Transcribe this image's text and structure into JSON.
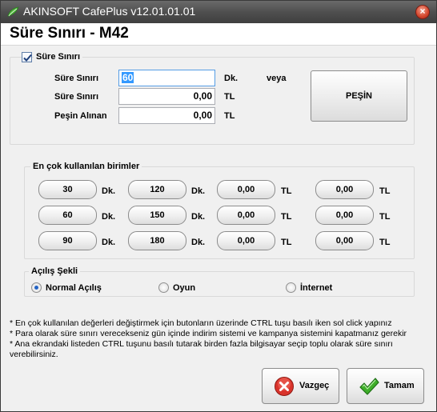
{
  "window": {
    "title": "AKINSOFT CafePlus v12.01.01.01",
    "close_symbol": "×"
  },
  "header": {
    "title": "Süre Sınırı - M42"
  },
  "limit_group": {
    "legend": "Süre Sınırı",
    "checked": true,
    "rows": [
      {
        "label": "Süre Sınırı",
        "value": "60",
        "unit": "Dk.",
        "extra": "veya"
      },
      {
        "label": "Süre Sınırı",
        "value": "0,00",
        "unit": "TL"
      },
      {
        "label": "Peşin Alınan",
        "value": "0,00",
        "unit": "TL"
      }
    ],
    "cash_button": "PEŞİN"
  },
  "common_units": {
    "legend": "En çok kullanılan birimler",
    "col1": [
      {
        "value": "30",
        "unit": "Dk."
      },
      {
        "value": "60",
        "unit": "Dk."
      },
      {
        "value": "90",
        "unit": "Dk."
      }
    ],
    "col2": [
      {
        "value": "120",
        "unit": "Dk."
      },
      {
        "value": "150",
        "unit": "Dk."
      },
      {
        "value": "180",
        "unit": "Dk."
      }
    ],
    "col3": [
      {
        "value": "0,00",
        "unit": "TL"
      },
      {
        "value": "0,00",
        "unit": "TL"
      },
      {
        "value": "0,00",
        "unit": "TL"
      }
    ],
    "col4": [
      {
        "value": "0,00",
        "unit": "TL"
      },
      {
        "value": "0,00",
        "unit": "TL"
      },
      {
        "value": "0,00",
        "unit": "TL"
      }
    ]
  },
  "open_mode": {
    "legend": "Açılış Şekli",
    "options": [
      {
        "label": "Normal Açılış",
        "selected": true
      },
      {
        "label": "Oyun",
        "selected": false
      },
      {
        "label": "İnternet",
        "selected": false
      }
    ]
  },
  "notes": [
    "* En çok kullanılan değerleri değiştirmek için butonların üzerinde CTRL tuşu basılı iken sol click yapınız",
    "* Para olarak süre sınırı verecekseniz gün içinde indirim sistemi ve kampanya sistemini kapatmanız gerekir",
    "* Ana ekrandaki listeden CTRL tuşunu basılı tutarak birden fazla bilgisayar seçip toplu olarak süre sınırı",
    "verebilirsiniz."
  ],
  "buttons": {
    "cancel": "Vazgeç",
    "ok": "Tamam"
  },
  "icons": {
    "app": "cafeplus-leaf-icon",
    "cancel": "red-x-icon",
    "ok": "green-check-icon"
  },
  "colors": {
    "titlebar": "#4f4f4f",
    "focus": "#569de5",
    "cancel_red": "#d9332b",
    "ok_green": "#3fae2a"
  }
}
